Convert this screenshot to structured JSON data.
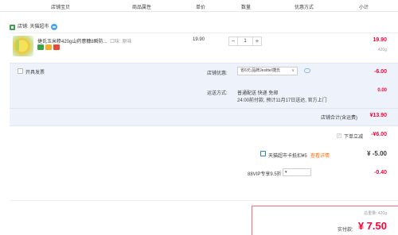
{
  "header": {
    "col_shop": "店铺宝贝",
    "col_props": "商品属性",
    "col_unit_price": "单价",
    "col_qty": "数量",
    "col_promo": "优惠方式",
    "col_subtotal": "小计"
  },
  "shop": {
    "label": "店铺: 天猫超市"
  },
  "item": {
    "name": "捷氏玉米糁420g山药薏糠8瞬防...",
    "props": "口味: 原味",
    "unit_price": "19.90",
    "quantity": "1",
    "minus": "−",
    "plus": "+",
    "subtotal": "19.90",
    "weight": "420g"
  },
  "invoice": {
    "label": "开具发票"
  },
  "promo": {
    "label": "店铺优惠:",
    "selected": "省6元:品牌Jesitte/捷氏",
    "amount": "-6.00"
  },
  "shipping": {
    "label": "运送方式:",
    "method": "普通配送 快递 免邮",
    "eta": "24:00前付款, 预计11月17日送达, 官方上门",
    "amount": "0.00"
  },
  "store_total": {
    "label": "店铺合计(含运费)",
    "amount": "¥13.90"
  },
  "instant_discount": {
    "label": "下单立减",
    "amount": "-¥6.00"
  },
  "card": {
    "label": "天猫超市卡抵扣¥5",
    "link": "查看详情",
    "amount": "¥ -5.00"
  },
  "vip": {
    "label": "88VIP专享9.5折",
    "amount": "-0.40"
  },
  "final": {
    "weight_label": "总重量: 420g",
    "pay_label": "实付款:",
    "amount": "¥ 7.50"
  },
  "colors": {
    "accent_red": "#ff0036",
    "link_orange": "#ff6a00",
    "promo_bg": "#eef3fb"
  }
}
